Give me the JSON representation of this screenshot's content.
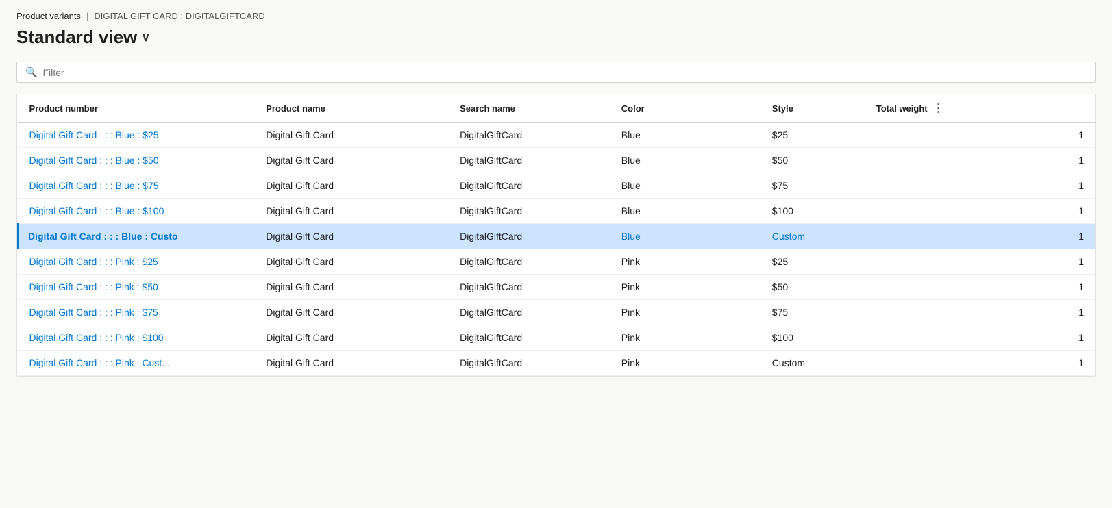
{
  "breadcrumb": {
    "item1": "Product variants",
    "separator": "|",
    "item2": "DIGITAL GIFT CARD : DIGITALGIFTCARD"
  },
  "page_title": "Standard view",
  "page_title_chevron": "∨",
  "filter": {
    "placeholder": "Filter"
  },
  "table": {
    "columns": [
      {
        "key": "product_number",
        "label": "Product number"
      },
      {
        "key": "product_name",
        "label": "Product name"
      },
      {
        "key": "search_name",
        "label": "Search name"
      },
      {
        "key": "color",
        "label": "Color"
      },
      {
        "key": "style",
        "label": "Style"
      },
      {
        "key": "total_weight",
        "label": "Total weight"
      }
    ],
    "rows": [
      {
        "product_number": "Digital Gift Card : : : Blue : $25",
        "product_name": "Digital Gift Card",
        "search_name": "DigitalGiftCard",
        "color": "Blue",
        "style": "$25",
        "total_weight": "1",
        "selected": false
      },
      {
        "product_number": "Digital Gift Card : : : Blue : $50",
        "product_name": "Digital Gift Card",
        "search_name": "DigitalGiftCard",
        "color": "Blue",
        "style": "$50",
        "total_weight": "1",
        "selected": false
      },
      {
        "product_number": "Digital Gift Card : : : Blue : $75",
        "product_name": "Digital Gift Card",
        "search_name": "DigitalGiftCard",
        "color": "Blue",
        "style": "$75",
        "total_weight": "1",
        "selected": false
      },
      {
        "product_number": "Digital Gift Card : : : Blue : $100",
        "product_name": "Digital Gift Card",
        "search_name": "DigitalGiftCard",
        "color": "Blue",
        "style": "$100",
        "total_weight": "1",
        "selected": false
      },
      {
        "product_number": "Digital Gift Card : : : Blue : Custo",
        "product_number_display": "Digital Gift Card : : : Blue : Custo",
        "product_name": "Digital Gift Card",
        "search_name": "DigitalGiftCard",
        "color": "Blue",
        "style": "Custom",
        "total_weight": "1",
        "selected": true
      },
      {
        "product_number": "Digital Gift Card : : : Pink : $25",
        "product_name": "Digital Gift Card",
        "search_name": "DigitalGiftCard",
        "color": "Pink",
        "style": "$25",
        "total_weight": "1",
        "selected": false
      },
      {
        "product_number": "Digital Gift Card : : : Pink : $50",
        "product_name": "Digital Gift Card",
        "search_name": "DigitalGiftCard",
        "color": "Pink",
        "style": "$50",
        "total_weight": "1",
        "selected": false
      },
      {
        "product_number": "Digital Gift Card : : : Pink : $75",
        "product_name": "Digital Gift Card",
        "search_name": "DigitalGiftCard",
        "color": "Pink",
        "style": "$75",
        "total_weight": "1",
        "selected": false
      },
      {
        "product_number": "Digital Gift Card : : : Pink : $100",
        "product_name": "Digital Gift Card",
        "search_name": "DigitalGiftCard",
        "color": "Pink",
        "style": "$100",
        "total_weight": "1",
        "selected": false
      },
      {
        "product_number": "Digital Gift Card : : : Pink : Cust...",
        "product_name": "Digital Gift Card",
        "search_name": "DigitalGiftCard",
        "color": "Pink",
        "style": "Custom",
        "total_weight": "1",
        "selected": false
      }
    ]
  }
}
